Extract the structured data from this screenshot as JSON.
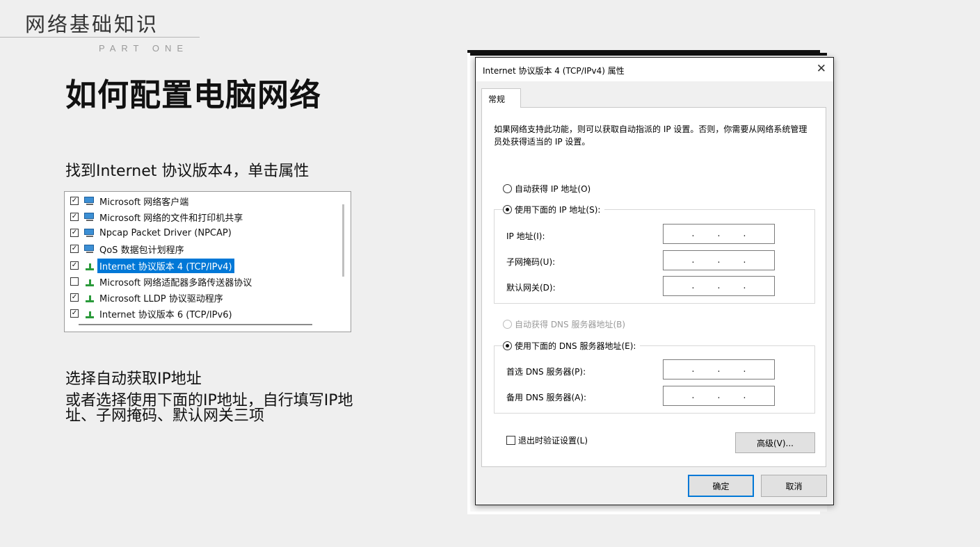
{
  "slide": {
    "topic": "网络基础知识",
    "part": "PART ONE",
    "title": "如何配置电脑网络",
    "step1": "找到Internet 协议版本4，单击属性",
    "step2": "选择自动获取IP地址",
    "step3": "或者选择使用下面的IP地址，自行填写IP地址、子网掩码、默认网关三项"
  },
  "components": [
    {
      "label": "Microsoft 网络客户端",
      "checked": true,
      "icon": "network-client-icon",
      "selected": false
    },
    {
      "label": "Microsoft 网络的文件和打印机共享",
      "checked": true,
      "icon": "network-client-icon",
      "selected": false
    },
    {
      "label": "Npcap Packet Driver (NPCAP)",
      "checked": true,
      "icon": "network-client-icon",
      "selected": false
    },
    {
      "label": "QoS 数据包计划程序",
      "checked": true,
      "icon": "network-client-icon",
      "selected": false
    },
    {
      "label": "Internet 协议版本 4 (TCP/IPv4)",
      "checked": true,
      "icon": "protocol-icon",
      "selected": true
    },
    {
      "label": "Microsoft 网络适配器多路传送器协议",
      "checked": false,
      "icon": "protocol-icon",
      "selected": false
    },
    {
      "label": "Microsoft LLDP 协议驱动程序",
      "checked": true,
      "icon": "protocol-icon",
      "selected": false
    },
    {
      "label": "Internet 协议版本 6 (TCP/IPv6)",
      "checked": true,
      "icon": "protocol-icon",
      "selected": false
    }
  ],
  "dialog": {
    "title": "Internet 协议版本 4 (TCP/IPv4) 属性",
    "close": "✕",
    "tab": "常规",
    "description": "如果网络支持此功能，则可以获取自动指派的 IP 设置。否则，你需要从网络系统管理员处获得适当的 IP 设置。",
    "auto_ip": "自动获得 IP 地址(O)",
    "manual_ip": "使用下面的 IP 地址(S):",
    "ip_label": "IP 地址(I):",
    "mask_label": "子网掩码(U):",
    "gateway_label": "默认网关(D):",
    "auto_dns": "自动获得 DNS 服务器地址(B)",
    "manual_dns": "使用下面的 DNS 服务器地址(E):",
    "dns_pref_label": "首选 DNS 服务器(P):",
    "dns_alt_label": "备用 DNS 服务器(A):",
    "ip_dot": ".",
    "validate_label": "退出时验证设置(L)",
    "advanced": "高级(V)...",
    "ok": "确定",
    "cancel": "取消",
    "selected_ip_mode": "manual",
    "selected_dns_mode": "manual"
  },
  "colors": {
    "selection": "#0078d7",
    "background": "#efefef"
  }
}
